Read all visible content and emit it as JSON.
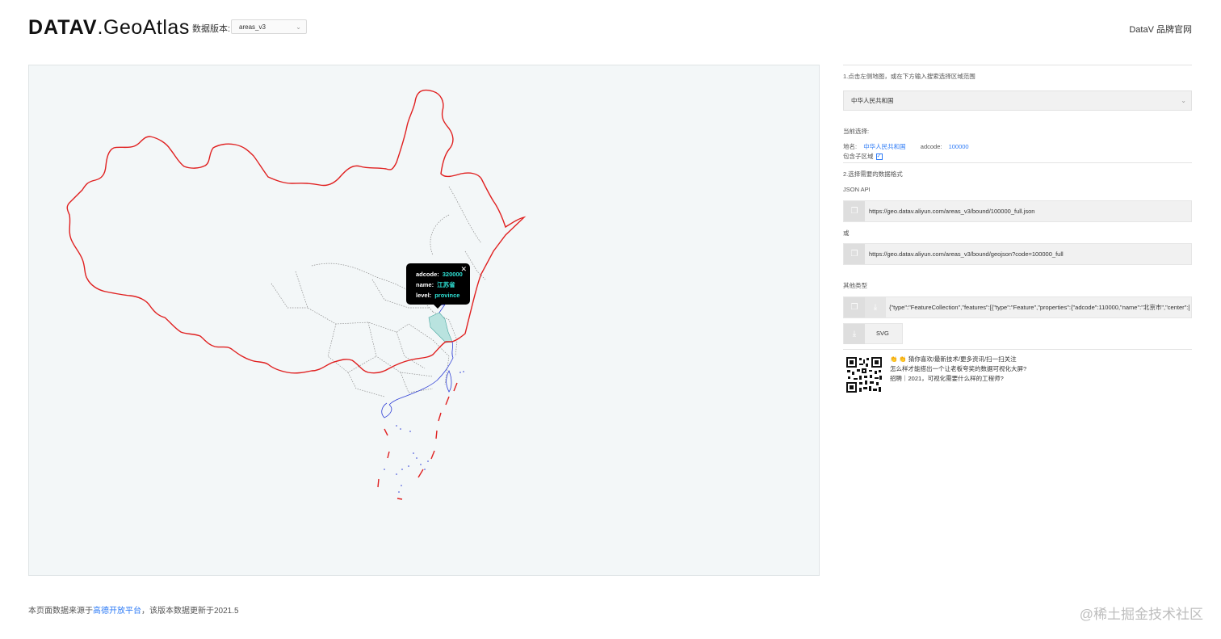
{
  "header": {
    "logo_bold": "DATAV",
    "logo_light": ".GeoAtlas",
    "version_label": "数据版本:",
    "version_value": "areas_v3",
    "brand_link": "DataV 品牌官网"
  },
  "tooltip": {
    "adcode_label": "adcode:",
    "adcode_value": "320000",
    "name_label": "name:",
    "name_value": "江苏省",
    "level_label": "level:",
    "level_value": "province",
    "close_glyph": "✕"
  },
  "panel": {
    "step1": "1.点击左侧地图，或在下方输入搜索选择区域范围",
    "region_value": "中华人民共和国",
    "current_label": "当前选择:",
    "place_label": "地名:",
    "place_value": "中华人民共和国",
    "adcode_label": "adcode:",
    "adcode_value": "100000",
    "include_sub": "包含子区域",
    "step2": "2.选择需要的数据格式",
    "json_api_label": "JSON API",
    "api_url_1": "https://geo.datav.aliyun.com/areas_v3/bound/100000_full.json",
    "or_label": "或",
    "api_url_2": "https://geo.datav.aliyun.com/areas_v3/bound/geojson?code=100000_full",
    "other_label": "其他类型",
    "geojson_preview": "{\"type\":\"FeatureCollection\",\"features\":[{\"type\":\"Feature\",\"properties\":{\"adcode\":110000,\"name\":\"北京市\",\"center\":[116.40",
    "svg_label": "SVG",
    "promo_1": "👏 👏 猜你喜欢/最新技术/更多资讯/扫一扫关注",
    "promo_2": "怎么样才能搭出一个让老板夸奖的数据可视化大屏?",
    "promo_3": "招聘｜2021，可视化需要什么样的工程师?"
  },
  "footer": {
    "prefix": "本页面数据来源于",
    "link": "高德开放平台",
    "suffix": "，该版本数据更新于2021.5"
  },
  "watermark": "@稀土掘金技术社区",
  "colors": {
    "border_red": "#e02020",
    "coast_blue": "#2f3fd6",
    "highlight": "#b9e3df",
    "accent_blue": "#2e7bf6",
    "tooltip_value": "#2fe3d6"
  },
  "icons": {
    "copy": "copy-icon",
    "download": "download-icon",
    "chevron": "chevron-down-icon",
    "close": "close-icon",
    "check": "checkbox-icon"
  }
}
